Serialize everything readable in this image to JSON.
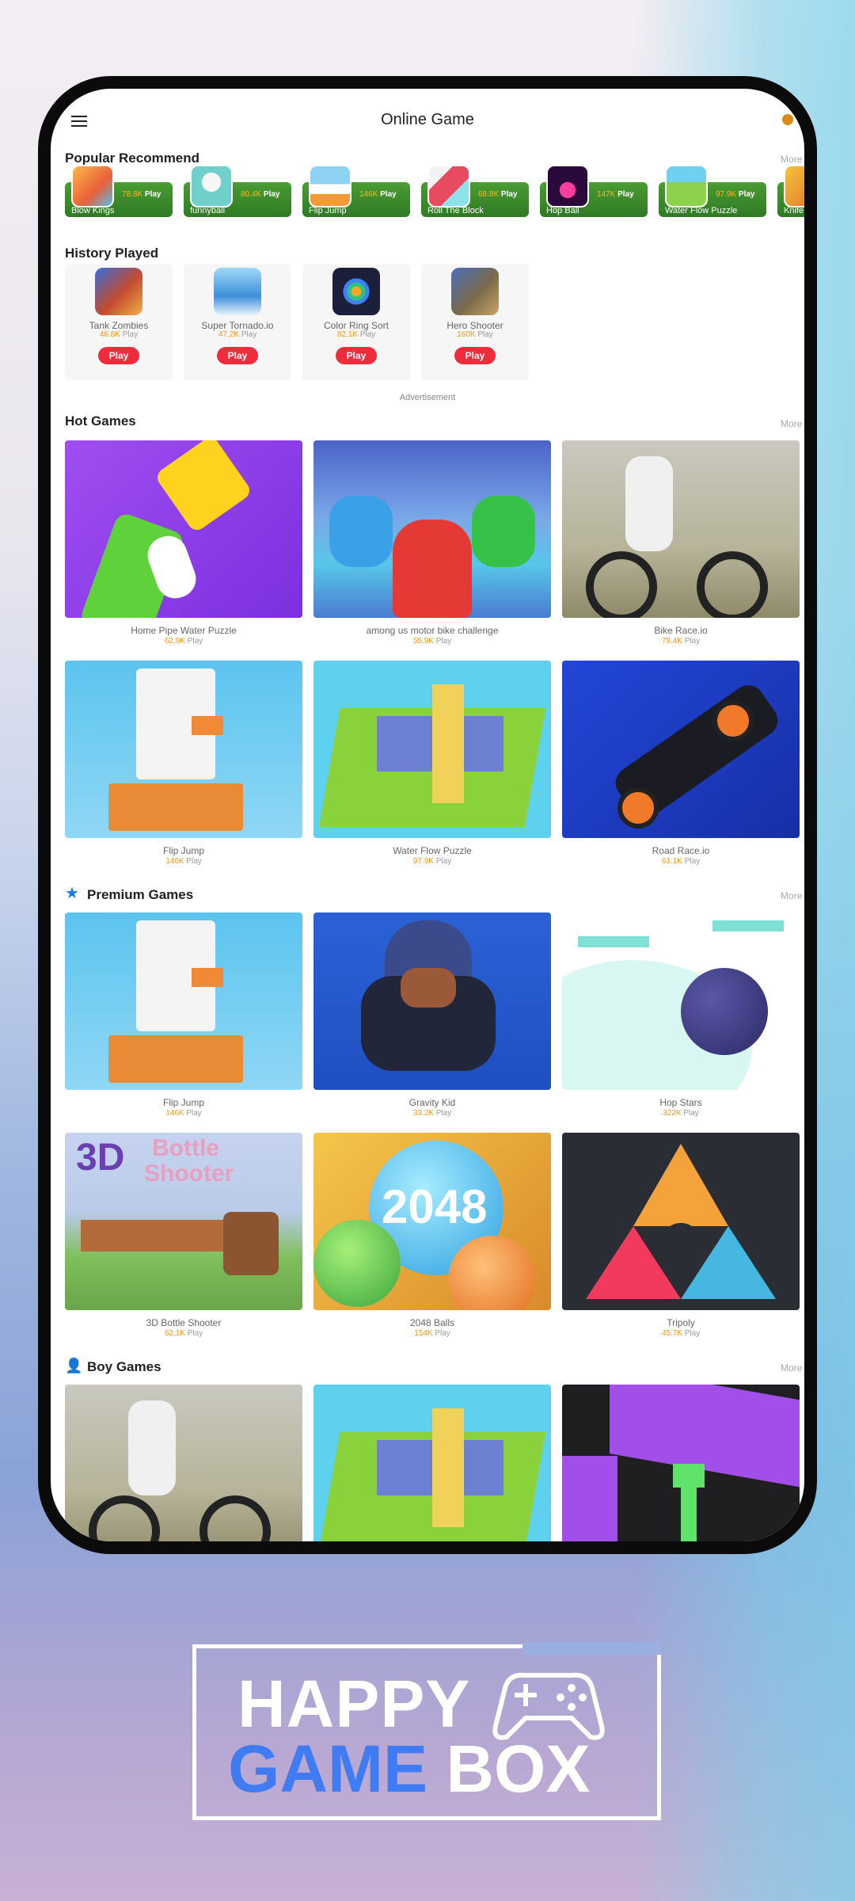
{
  "header": {
    "title": "Online Game"
  },
  "sections": {
    "popular": {
      "title": "Popular Recommend",
      "more": "More"
    },
    "history": {
      "title": "History Played"
    },
    "hot": {
      "title": "Hot Games",
      "more": "More"
    },
    "premium": {
      "title": "Premium Games",
      "more": "More"
    },
    "boy": {
      "title": "Boy Games",
      "more": "More"
    }
  },
  "popular_items": [
    {
      "name": "Blow Kings",
      "count": "78.8K",
      "play": "Play"
    },
    {
      "name": "funnyball",
      "count": "80.4K",
      "play": "Play"
    },
    {
      "name": "Flip Jump",
      "count": "146K",
      "play": "Play"
    },
    {
      "name": "Roll The Block",
      "count": "68.8K",
      "play": "Play"
    },
    {
      "name": "Hop Ball",
      "count": "147K",
      "play": "Play"
    },
    {
      "name": "Water Flow Puzzle",
      "count": "97.9K",
      "play": "Play"
    },
    {
      "name": "Knife",
      "count": "",
      "play": ""
    }
  ],
  "history_items": [
    {
      "name": "Tank Zombies",
      "count": "46.8K",
      "suffix": "Play",
      "button": "Play"
    },
    {
      "name": "Super Tornado.io",
      "count": "47.2K",
      "suffix": "Play",
      "button": "Play"
    },
    {
      "name": "Color Ring Sort",
      "count": "82.1K",
      "suffix": "Play",
      "button": "Play"
    },
    {
      "name": "Hero Shooter",
      "count": "160K",
      "suffix": "Play",
      "button": "Play"
    }
  ],
  "ad_label": "Advertisement",
  "hot_games": [
    {
      "name": "Home Pipe Water Puzzle",
      "count": "62.9K",
      "suffix": "Play"
    },
    {
      "name": "among us motor bike challenge",
      "count": "55.9K",
      "suffix": "Play"
    },
    {
      "name": "Bike Race.io",
      "count": "79.4K",
      "suffix": "Play"
    },
    {
      "name": "Flip Jump",
      "count": "146K",
      "suffix": "Play"
    },
    {
      "name": "Water Flow Puzzle",
      "count": "97.9K",
      "suffix": "Play"
    },
    {
      "name": "Road Race.io",
      "count": "61.1K",
      "suffix": "Play"
    }
  ],
  "premium_games": [
    {
      "name": "Flip Jump",
      "count": "146K",
      "suffix": "Play"
    },
    {
      "name": "Gravity Kid",
      "count": "33.2K",
      "suffix": "Play"
    },
    {
      "name": "Hop Stars",
      "count": "322K",
      "suffix": "Play"
    },
    {
      "name": "3D Bottle Shooter",
      "count": "62.1K",
      "suffix": "Play"
    },
    {
      "name": "2048 Balls",
      "count": "154K",
      "suffix": "Play"
    },
    {
      "name": "Tripoly",
      "count": "45.7K",
      "suffix": "Play"
    }
  ],
  "thumb_text": {
    "bottle_line1": "3D",
    "bottle_line2": "Bottle",
    "bottle_line3": "Shooter",
    "ball_number": "2048"
  },
  "logo": {
    "line1": "HAPPY",
    "line2_blue": "GAME",
    "line2_white": "BOX"
  },
  "colors": {
    "accent_green": "#3d8a2c",
    "play_red": "#ee2c3c",
    "count_orange": "#f29a1d",
    "section_icon_blue": "#1d7be8",
    "logo_blue": "#3f7cf3"
  }
}
